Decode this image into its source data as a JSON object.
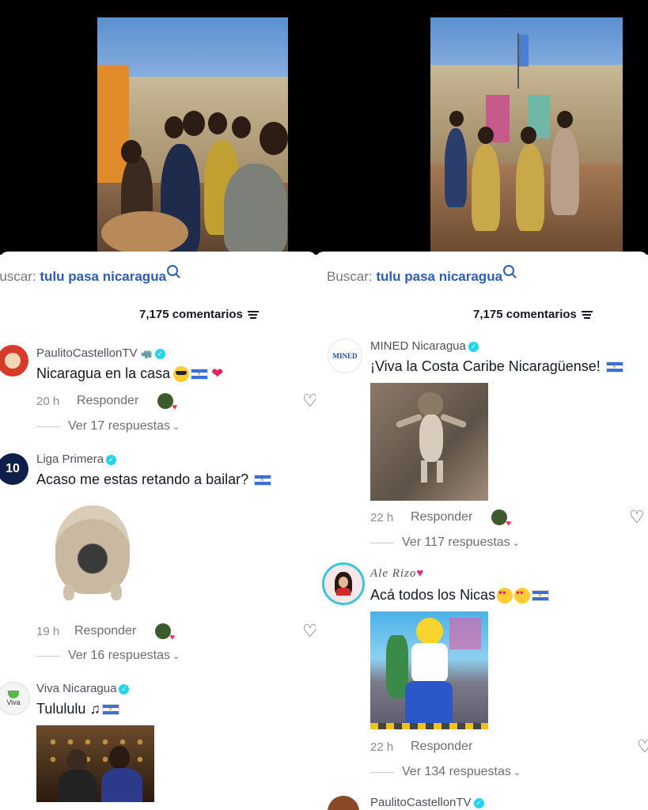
{
  "left": {
    "search": {
      "label": "Buscar:",
      "term": "tulu pasa nicaragua"
    },
    "comment_count": "7,175 comentarios",
    "comments": [
      {
        "username": "PaulitoCastellonTV",
        "text": "Nicaragua en la casa",
        "time": "20 h",
        "reply": "Responder",
        "replies": "Ver 17 respuestas"
      },
      {
        "username": "Liga Primera",
        "text": "Acaso me estas retando a bailar?",
        "time": "19 h",
        "reply": "Responder",
        "replies": "Ver 16 respuestas"
      },
      {
        "username": "Viva Nicaragua",
        "text": "Tulululu",
        "avatar_text": "Viva"
      }
    ]
  },
  "right": {
    "search": {
      "label": "Buscar:",
      "term": "tulu pasa nicaragua"
    },
    "comment_count": "7,175 comentarios",
    "comments": [
      {
        "username": "MINED Nicaragua",
        "text": "¡Viva la Costa Caribe Nicaragüense!",
        "time": "22 h",
        "reply": "Responder",
        "replies": "Ver 117 respuestas",
        "avatar_text": "MINED"
      },
      {
        "username": "Ale Rizo",
        "text": "Acá todos los Nicas",
        "time": "22 h",
        "reply": "Responder",
        "replies": "Ver 134 respuestas"
      },
      {
        "username": "PaulitoCastellonTV"
      }
    ]
  },
  "colors": {
    "search_term": "#2b5db9",
    "verified": "#20d5ec",
    "heart": "#fe2c55"
  }
}
